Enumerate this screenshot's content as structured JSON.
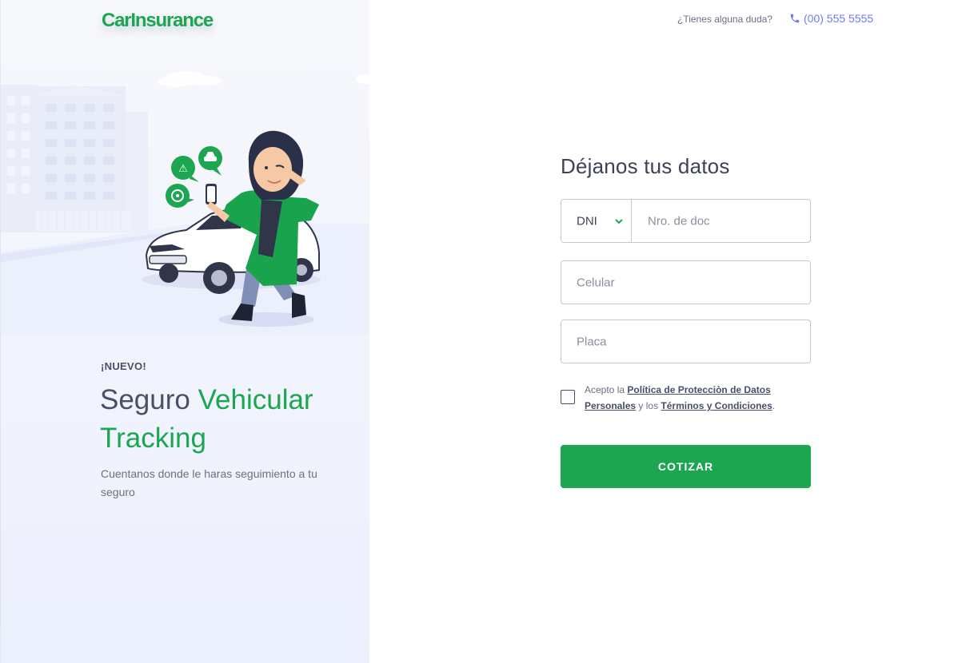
{
  "brand": {
    "logo": "CarInsurance",
    "accent": "#1ca651",
    "link_color": "#6f7cf0"
  },
  "header": {
    "help_text": "¿Tienes alguna duda?",
    "phone_icon": "phone-icon",
    "phone": "(00) 555 5555"
  },
  "hero": {
    "badge": "¡NUEVO!",
    "title_part1": "Seguro",
    "title_accent_1": "Vehicular",
    "title_accent_2": "Tracking",
    "subtitle": "Cuentanos donde le haras seguimiento a tu seguro"
  },
  "form": {
    "title": "Déjanos tus datos",
    "doc_type": "DNI",
    "doc_placeholder": "Nro. de doc",
    "phone_placeholder": "Celular",
    "plate_placeholder": "Placa",
    "terms_prefix": "Acepto la",
    "terms_link1": "Política de Protecciòn de Datos Personales",
    "terms_mid": "y los",
    "terms_link2": "Términos y Condiciones",
    "terms_suffix": ".",
    "submit": "COTIZAR"
  }
}
